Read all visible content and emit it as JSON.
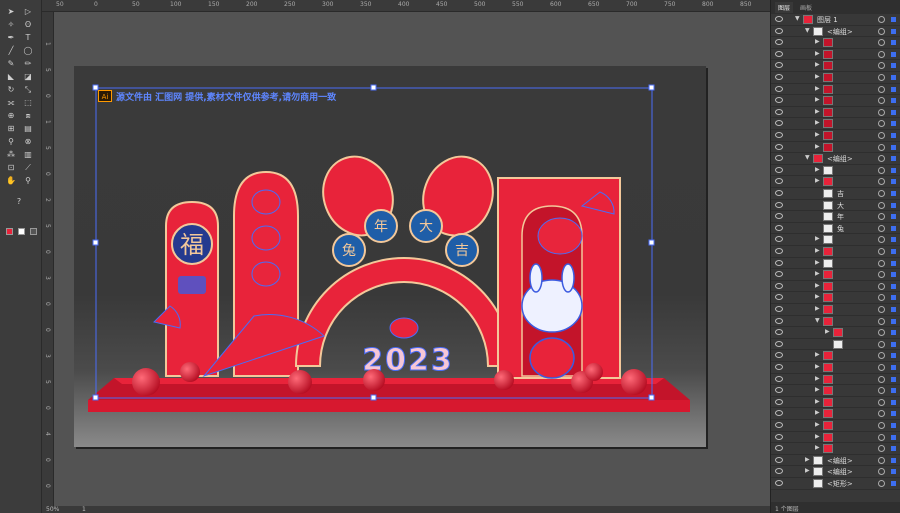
{
  "toolbar": {
    "tools": [
      {
        "name": "selection-tool",
        "glyph": "➤"
      },
      {
        "name": "direct-selection-tool",
        "glyph": "▷"
      },
      {
        "name": "magic-wand-tool",
        "glyph": "✧"
      },
      {
        "name": "lasso-tool",
        "glyph": "ʘ"
      },
      {
        "name": "pen-tool",
        "glyph": "✒"
      },
      {
        "name": "type-tool",
        "glyph": "T"
      },
      {
        "name": "line-tool",
        "glyph": "╱"
      },
      {
        "name": "ellipse-tool",
        "glyph": "◯"
      },
      {
        "name": "paintbrush-tool",
        "glyph": "✎"
      },
      {
        "name": "pencil-tool",
        "glyph": "✏"
      },
      {
        "name": "blob-brush-tool",
        "glyph": "◣"
      },
      {
        "name": "eraser-tool",
        "glyph": "◪"
      },
      {
        "name": "rotate-tool",
        "glyph": "↻"
      },
      {
        "name": "scale-tool",
        "glyph": "⤡"
      },
      {
        "name": "width-tool",
        "glyph": "⟗"
      },
      {
        "name": "free-transform-tool",
        "glyph": "⬚"
      },
      {
        "name": "shape-builder-tool",
        "glyph": "⊕"
      },
      {
        "name": "perspective-tool",
        "glyph": "⧈"
      },
      {
        "name": "mesh-tool",
        "glyph": "⊞"
      },
      {
        "name": "gradient-tool",
        "glyph": "▤"
      },
      {
        "name": "eyedropper-tool",
        "glyph": "⚲"
      },
      {
        "name": "blend-tool",
        "glyph": "⊗"
      },
      {
        "name": "symbol-sprayer-tool",
        "glyph": "⁂"
      },
      {
        "name": "column-graph-tool",
        "glyph": "▥"
      },
      {
        "name": "artboard-tool",
        "glyph": "⊡"
      },
      {
        "name": "slice-tool",
        "glyph": "⟋"
      },
      {
        "name": "hand-tool",
        "glyph": "✋"
      },
      {
        "name": "zoom-tool",
        "glyph": "⚲"
      }
    ],
    "help_glyph": "?"
  },
  "ruler": {
    "top_ticks": [
      "50",
      "0",
      "50",
      "100",
      "150",
      "200",
      "250",
      "300",
      "350",
      "400",
      "450",
      "500",
      "550",
      "600",
      "650",
      "700",
      "750",
      "800",
      "850",
      "900"
    ],
    "left_ticks": [
      "1",
      "5",
      "0",
      "1",
      "5",
      "0",
      "2",
      "5",
      "0",
      "3",
      "0",
      "0",
      "3",
      "5",
      "0",
      "4",
      "0",
      "0"
    ]
  },
  "canvas": {
    "ai_badge": "Ai",
    "note_text": "源文件由 汇图网 提供,素材文件仅供参考,请勿商用一致",
    "arch_chars": [
      "兔",
      "年",
      "大",
      "吉"
    ],
    "fu_char": "福",
    "year_text": "2023",
    "colors": {
      "red": "#e8233a",
      "dark_red": "#c3142a",
      "gold": "#f3c89a",
      "blue_sel": "#4a6cf7",
      "lantern": "#e8253c"
    }
  },
  "layers_panel": {
    "tabs": [
      "图层",
      "画板"
    ],
    "top_layer": "图层 1",
    "group_label": "<编组>",
    "rows": [
      {
        "indent": 0,
        "label": "图层 1",
        "arrow": "▼",
        "thumb": "#e8233a"
      },
      {
        "indent": 1,
        "label": "<编组>",
        "arrow": "▼",
        "thumb": "#eee"
      },
      {
        "indent": 2,
        "label": "",
        "arrow": "▶",
        "thumb": "#c3142a"
      },
      {
        "indent": 2,
        "label": "",
        "arrow": "▶",
        "thumb": "#c3142a"
      },
      {
        "indent": 2,
        "label": "",
        "arrow": "▶",
        "thumb": "#c3142a"
      },
      {
        "indent": 2,
        "label": "",
        "arrow": "▶",
        "thumb": "#c3142a"
      },
      {
        "indent": 2,
        "label": "",
        "arrow": "▶",
        "thumb": "#c3142a"
      },
      {
        "indent": 2,
        "label": "",
        "arrow": "▶",
        "thumb": "#c3142a"
      },
      {
        "indent": 2,
        "label": "",
        "arrow": "▶",
        "thumb": "#c3142a"
      },
      {
        "indent": 2,
        "label": "",
        "arrow": "▶",
        "thumb": "#c3142a"
      },
      {
        "indent": 2,
        "label": "",
        "arrow": "▶",
        "thumb": "#c3142a"
      },
      {
        "indent": 2,
        "label": "",
        "arrow": "▶",
        "thumb": "#c3142a"
      },
      {
        "indent": 1,
        "label": "<编组>",
        "arrow": "▼",
        "thumb": "#e8233a"
      },
      {
        "indent": 2,
        "label": "",
        "arrow": "▶",
        "thumb": "#eee"
      },
      {
        "indent": 2,
        "label": "",
        "arrow": "▶",
        "thumb": "#e8233a"
      },
      {
        "indent": 2,
        "label": "吉",
        "arrow": "",
        "thumb": "#eee"
      },
      {
        "indent": 2,
        "label": "大",
        "arrow": "",
        "thumb": "#eee"
      },
      {
        "indent": 2,
        "label": "年",
        "arrow": "",
        "thumb": "#eee"
      },
      {
        "indent": 2,
        "label": "兔",
        "arrow": "",
        "thumb": "#eee"
      },
      {
        "indent": 2,
        "label": "",
        "arrow": "▶",
        "thumb": "#eee"
      },
      {
        "indent": 2,
        "label": "",
        "arrow": "▶",
        "thumb": "#e8233a"
      },
      {
        "indent": 2,
        "label": "",
        "arrow": "▶",
        "thumb": "#eee"
      },
      {
        "indent": 2,
        "label": "",
        "arrow": "▶",
        "thumb": "#e8233a"
      },
      {
        "indent": 2,
        "label": "",
        "arrow": "▶",
        "thumb": "#e8233a"
      },
      {
        "indent": 2,
        "label": "",
        "arrow": "▶",
        "thumb": "#e8233a"
      },
      {
        "indent": 2,
        "label": "",
        "arrow": "▶",
        "thumb": "#e8233a"
      },
      {
        "indent": 2,
        "label": "",
        "arrow": "▼",
        "thumb": "#e8233a"
      },
      {
        "indent": 3,
        "label": "",
        "arrow": "▶",
        "thumb": "#e8233a"
      },
      {
        "indent": 3,
        "label": "",
        "arrow": "",
        "thumb": "#eee"
      },
      {
        "indent": 2,
        "label": "",
        "arrow": "▶",
        "thumb": "#e8233a"
      },
      {
        "indent": 2,
        "label": "",
        "arrow": "▶",
        "thumb": "#e8233a"
      },
      {
        "indent": 2,
        "label": "",
        "arrow": "▶",
        "thumb": "#e8233a"
      },
      {
        "indent": 2,
        "label": "",
        "arrow": "▶",
        "thumb": "#e8233a"
      },
      {
        "indent": 2,
        "label": "",
        "arrow": "▶",
        "thumb": "#e8233a"
      },
      {
        "indent": 2,
        "label": "",
        "arrow": "▶",
        "thumb": "#e8233a"
      },
      {
        "indent": 2,
        "label": "",
        "arrow": "▶",
        "thumb": "#e8233a"
      },
      {
        "indent": 2,
        "label": "",
        "arrow": "▶",
        "thumb": "#e8233a"
      },
      {
        "indent": 2,
        "label": "",
        "arrow": "▶",
        "thumb": "#e8233a"
      },
      {
        "indent": 1,
        "label": "<编组>",
        "arrow": "▶",
        "thumb": "#eee"
      },
      {
        "indent": 1,
        "label": "<编组>",
        "arrow": "▶",
        "thumb": "#eee"
      },
      {
        "indent": 1,
        "label": "<矩形>",
        "arrow": "",
        "thumb": "#eee"
      }
    ],
    "footer": "1 个图层"
  },
  "status": {
    "zoom": "50%",
    "page": "1"
  }
}
